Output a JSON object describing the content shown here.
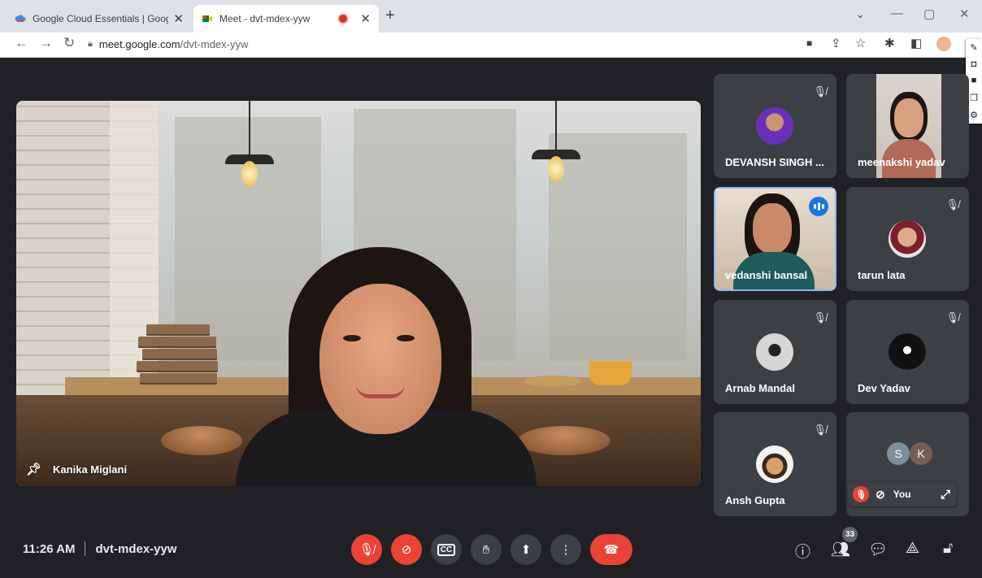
{
  "browser": {
    "tabs": [
      {
        "title": "Google Cloud Essentials | Google",
        "active": false
      },
      {
        "title": "Meet - dvt-mdex-yyw",
        "active": true
      }
    ],
    "address_host": "meet.google.com",
    "address_path": "/dvt-mdex-yyw"
  },
  "main_speaker": {
    "name": "Kanika Miglani",
    "pinned": true
  },
  "participants": [
    {
      "name": "DEVANSH SINGH ...",
      "muted": true,
      "mode": "avatar"
    },
    {
      "name": "meenakshi yadav",
      "muted": false,
      "mode": "video"
    },
    {
      "name": "vedanshi bansal",
      "muted": false,
      "mode": "video",
      "speaking": true
    },
    {
      "name": "tarun lata",
      "muted": true,
      "mode": "avatar"
    },
    {
      "name": "Arnab Mandal",
      "muted": true,
      "mode": "avatar"
    },
    {
      "name": "Dev Yadav",
      "muted": true,
      "mode": "avatar"
    },
    {
      "name": "Ansh Gupta",
      "muted": true,
      "mode": "avatar"
    }
  ],
  "others_tile": {
    "initials": [
      "S",
      "K"
    ]
  },
  "self_view": {
    "label": "You"
  },
  "meeting": {
    "time": "11:26 AM",
    "code": "dvt-mdex-yyw"
  },
  "people_count": "33",
  "colors": {
    "accent": "#1a73e8",
    "danger": "#ea4335",
    "surface": "#3c4043",
    "background": "#202124"
  }
}
